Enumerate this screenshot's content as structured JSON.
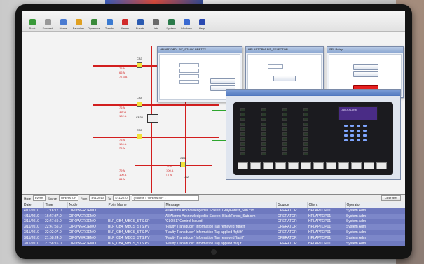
{
  "toolbar": {
    "buttons": [
      {
        "label": "Back",
        "icon": "back-arrow-icon",
        "color": "#3a9a3a"
      },
      {
        "label": "Forward",
        "icon": "forward-arrow-icon",
        "color": "#999999"
      },
      {
        "label": "Home",
        "icon": "home-icon",
        "color": "#4a7bd1"
      },
      {
        "label": "Favorites",
        "icon": "star-icon",
        "color": "#e0a020"
      },
      {
        "label": "Dynamics",
        "icon": "dynamics-icon",
        "color": "#3a8a3a"
      },
      {
        "label": "Trends",
        "icon": "trends-icon",
        "color": "#3a7ad1"
      },
      {
        "label": "Alarms",
        "icon": "alarms-icon",
        "color": "#d12a2a"
      },
      {
        "label": "Events",
        "icon": "events-icon",
        "color": "#2a5ab1"
      },
      {
        "label": "Lists",
        "icon": "lists-icon",
        "color": "#6a6a6a"
      },
      {
        "label": "System",
        "icon": "system-icon",
        "color": "#2a7a4a"
      },
      {
        "label": "Windows",
        "icon": "windows-icon",
        "color": "#3a6ad1"
      },
      {
        "label": "Help",
        "icon": "help-icon",
        "color": "#2a4ab1"
      }
    ]
  },
  "diagram": {
    "breakers": [
      "CB3",
      "CB4",
      "CB5",
      "CB6"
    ],
    "measurements": [
      [
        "75 A",
        "66 A",
        "77.3 A"
      ],
      [
        "76 A",
        "110 A",
        "102 A"
      ],
      [
        "75 A",
        "100 A",
        "79 A"
      ],
      [
        "79 A",
        "100 A",
        "64 A"
      ],
      [
        "75 A",
        "100 A",
        "47 A"
      ]
    ],
    "relay_label": "CB30",
    "line_labels": [
      "LS1",
      "LS2"
    ]
  },
  "popups": [
    {
      "title": "HPLAPTOP01 PIT_STALIC BRETTY"
    },
    {
      "title": "HPLAPTOP01 PIT_SELECTOR"
    },
    {
      "title": "SEL Relay"
    }
  ],
  "relay_panel": {
    "lcd_text": "LINE A ALARM"
  },
  "event_log": {
    "filters": {
      "mode_label": "Mode",
      "mode_value": "Events",
      "source_label": "Source",
      "source_value": "OPERATOR",
      "from_label": "From",
      "from_value": "4/11/2010",
      "to_label": "To",
      "to_value": "4/11/2010",
      "expr": "( Source = 'OPERATOR' )",
      "clear_label": "Clear filter"
    },
    "columns": [
      "Date",
      "Time",
      "Node",
      "Point Name",
      "Message",
      "Source",
      "Client",
      "Operator"
    ],
    "rows": [
      [
        "4/11/2010",
        "17:16:17.0",
        "CIPOWERDEMO",
        "",
        "All Alarms Acknowledged in Screen: GrayForest_Sub.cim",
        "OPERATOR",
        "HPLAPTOP01",
        "System Adm"
      ],
      [
        "4/11/2010",
        "16:47:37.0",
        "CIPOWERDEMO",
        "",
        "All Alarms Acknowledged in Screen: BlackForest_Sub.cim",
        "OPERATOR",
        "HPLAPTOP01",
        "System Adm"
      ],
      [
        "3/11/2010",
        "22:47:59.0",
        "CIPOWERDEMO",
        "BLF_CB4_MBCS_STS.SP",
        "'CLOSE' Control Issued",
        "OPERATOR",
        "HPLAPTOP01",
        "System Adm"
      ],
      [
        "3/11/2010",
        "22:47:55.0",
        "CIPOWERDEMO",
        "BLF_CB4_MBCS_STS.PV",
        "'Faulty Transducer' Information Tag removed 'fqhkfr'",
        "OPERATOR",
        "HPLAPTOP01",
        "System Adm"
      ],
      [
        "3/11/2010",
        "22:02:07.0",
        "CIPOWERDEMO",
        "BLF_CB4_MBCS_STS.PV",
        "'Faulty Transducer' Information Tag applied 'fqhkfr'",
        "OPERATOR",
        "HPLAPTOP01",
        "System Adm"
      ],
      [
        "3/11/2010",
        "21:58:24.0",
        "CIPOWERDEMO",
        "BLF_CB4_MBCS_STS.PV",
        "'Faulty Transducer' Information Tag removed 'fasj f'",
        "OPERATOR",
        "HPLAPTOP01",
        "System Adm"
      ],
      [
        "3/11/2010",
        "21:58:16.0",
        "CIPOWERDEMO",
        "BLF_CB4_MBCS_STS.PV",
        "'Faulty Transducer' Information Tag applied 'fasj f'",
        "OPERATOR",
        "HPLAPTOP01",
        "System Adm"
      ]
    ]
  }
}
